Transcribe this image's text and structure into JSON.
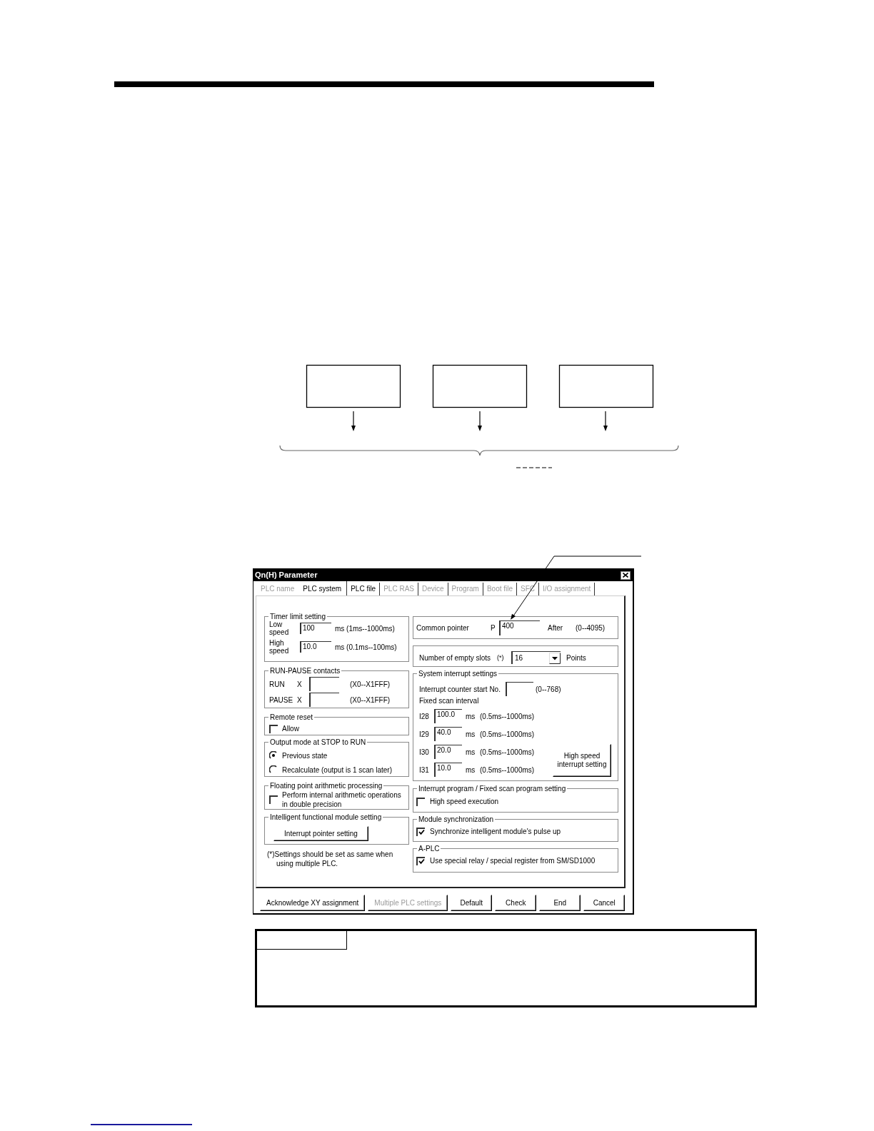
{
  "dialog": {
    "title": "Qn(H) Parameter",
    "tabs": [
      {
        "label": "PLC name",
        "selected": false,
        "disabled": true
      },
      {
        "label": "PLC system",
        "selected": true,
        "disabled": false
      },
      {
        "label": "PLC file",
        "selected": false,
        "disabled": false
      },
      {
        "label": "PLC RAS",
        "selected": false,
        "disabled": true
      },
      {
        "label": "Device",
        "selected": false,
        "disabled": true
      },
      {
        "label": "Program",
        "selected": false,
        "disabled": true
      },
      {
        "label": "Boot file",
        "selected": false,
        "disabled": true
      },
      {
        "label": "SFC",
        "selected": false,
        "disabled": true
      },
      {
        "label": "I/O assignment",
        "selected": false,
        "disabled": true
      }
    ],
    "timer_limit": {
      "title": "Timer limit setting",
      "rows": [
        {
          "label": "Low speed",
          "value": "100",
          "range": "ms (1ms--1000ms)"
        },
        {
          "label": "High speed",
          "value": "10.0",
          "range": "ms (0.1ms--100ms)"
        }
      ]
    },
    "run_pause": {
      "title": "RUN-PAUSE contacts",
      "rows": [
        {
          "label": "RUN",
          "prefix": "X",
          "range": "(X0--X1FFF)"
        },
        {
          "label": "PAUSE",
          "prefix": "X",
          "range": "(X0--X1FFF)"
        }
      ]
    },
    "remote_reset": {
      "title": "Remote reset",
      "checkbox": {
        "label": "Allow",
        "checked": false
      }
    },
    "output_mode": {
      "title": "Output mode at STOP to RUN",
      "options": [
        {
          "label": "Previous state",
          "selected": true
        },
        {
          "label": "Recalculate (output is 1 scan later)",
          "selected": false
        }
      ]
    },
    "floating_point": {
      "title": "Floating point arithmetic processing",
      "checkbox": {
        "label": "Perform internal arithmetic operations in double precision",
        "checked": false
      }
    },
    "intelligent_module": {
      "title": "Intelligent functional module setting",
      "button": "Interrupt pointer setting"
    },
    "note": "(*)Settings should be set as same when using multiple PLC.",
    "common_pointer": {
      "label": "Common pointer",
      "prefix": "P",
      "value": "400",
      "suffix": "After",
      "range": "(0--4095)"
    },
    "empty_slots": {
      "label": "Number of empty slots",
      "mark": "(*)",
      "value": "16",
      "unit": "Points"
    },
    "system_interrupt": {
      "title": "System interrupt settings",
      "counter": {
        "label": "Interrupt counter start No.",
        "range": "(0--768)"
      },
      "interval_label": "Fixed scan interval",
      "rows": [
        {
          "label": "I28",
          "value": "100.0",
          "unit": "ms",
          "range": "(0.5ms--1000ms)"
        },
        {
          "label": "I29",
          "value": "40.0",
          "unit": "ms",
          "range": "(0.5ms--1000ms)"
        },
        {
          "label": "I30",
          "value": "20.0",
          "unit": "ms",
          "range": "(0.5ms--1000ms)"
        },
        {
          "label": "I31",
          "value": "10.0",
          "unit": "ms",
          "range": "(0.5ms--1000ms)"
        }
      ],
      "button": "High speed interrupt setting"
    },
    "interrupt_program": {
      "title": "Interrupt program / Fixed scan program setting",
      "checkbox": {
        "label": "High speed execution",
        "checked": false
      }
    },
    "module_sync": {
      "title": "Module synchronization",
      "checkbox": {
        "label": "Synchronize intelligent module's pulse up",
        "checked": true
      }
    },
    "a_plc": {
      "title": "A-PLC",
      "checkbox": {
        "label": "Use special relay / special register from SM/SD1000",
        "checked": true
      }
    },
    "buttons": [
      {
        "label": "Acknowledge XY assignment",
        "disabled": false
      },
      {
        "label": "Multiple PLC settings",
        "disabled": true
      },
      {
        "label": "Default",
        "disabled": false
      },
      {
        "label": "Check",
        "disabled": false
      },
      {
        "label": "End",
        "disabled": false
      },
      {
        "label": "Cancel",
        "disabled": false
      }
    ]
  }
}
